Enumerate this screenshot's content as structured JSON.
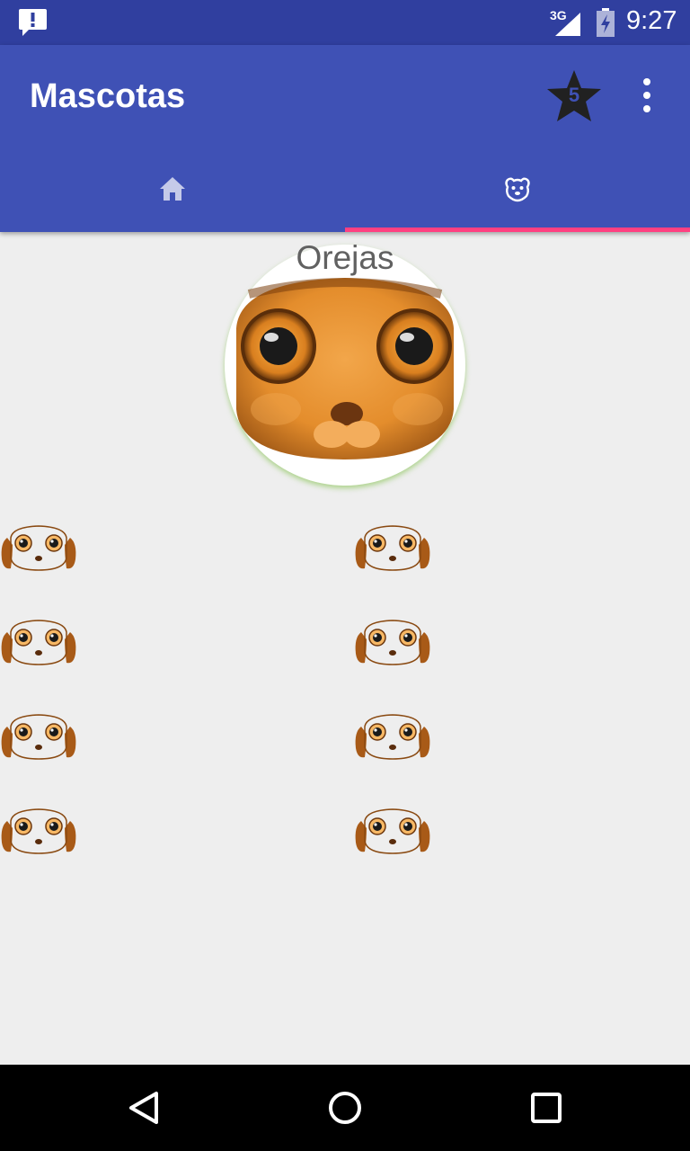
{
  "status_bar": {
    "network": "3G",
    "time": "9:27",
    "icons": [
      "notification-alert-icon",
      "signal-icon",
      "battery-charging-icon"
    ]
  },
  "app_bar": {
    "title": "Mascotas",
    "star_count": "5",
    "icons": [
      "star-icon",
      "more-vert-icon"
    ]
  },
  "tabs": [
    {
      "icon": "home-icon",
      "selected": false
    },
    {
      "icon": "dog-face-icon",
      "selected": true
    }
  ],
  "colors": {
    "status_bar": "#303f9f",
    "primary": "#3f51b5",
    "accent": "#ff4081",
    "background": "#eeeeee"
  },
  "profile": {
    "name": "Orejas",
    "photo_icon": "dog-face-photo"
  },
  "gallery": {
    "count": 8,
    "icon": "dog-face-icon"
  },
  "nav_bar": {
    "icons": [
      "back-icon",
      "home-circle-icon",
      "recents-icon"
    ]
  }
}
